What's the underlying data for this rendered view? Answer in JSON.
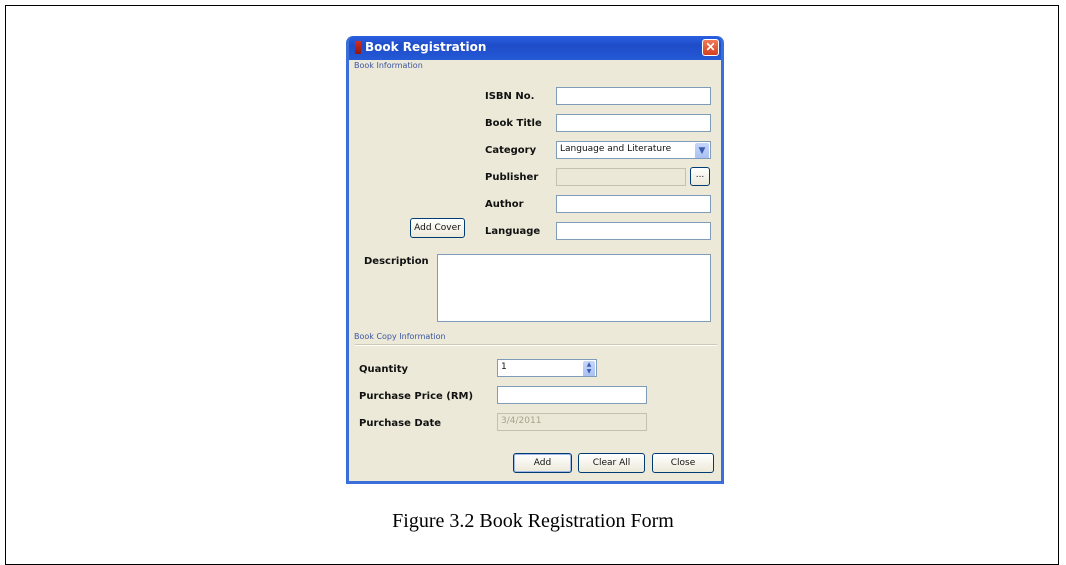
{
  "window": {
    "title": "Book Registration",
    "close_symbol": "✕"
  },
  "book_info": {
    "group_label": "Book Information",
    "isbn_label": "ISBN No.",
    "isbn_value": "",
    "title_label": "Book Title",
    "title_value": "",
    "category_label": "Category",
    "category_value": "Language and Literature",
    "publisher_label": "Publisher",
    "publisher_value": "",
    "browse_label": "...",
    "author_label": "Author",
    "author_value": "",
    "language_label": "Language",
    "language_value": "",
    "add_cover_label": "Add Cover",
    "description_label": "Description",
    "description_value": ""
  },
  "copy_info": {
    "group_label": "Book Copy Information",
    "quantity_label": "Quantity",
    "quantity_value": "1",
    "price_label": "Purchase Price (RM)",
    "price_value": "",
    "date_label": "Purchase Date",
    "date_value": "3/4/2011"
  },
  "buttons": {
    "add": "Add",
    "clear_all": "Clear All",
    "close": "Close"
  },
  "caption": "Figure 3.2 Book Registration Form"
}
